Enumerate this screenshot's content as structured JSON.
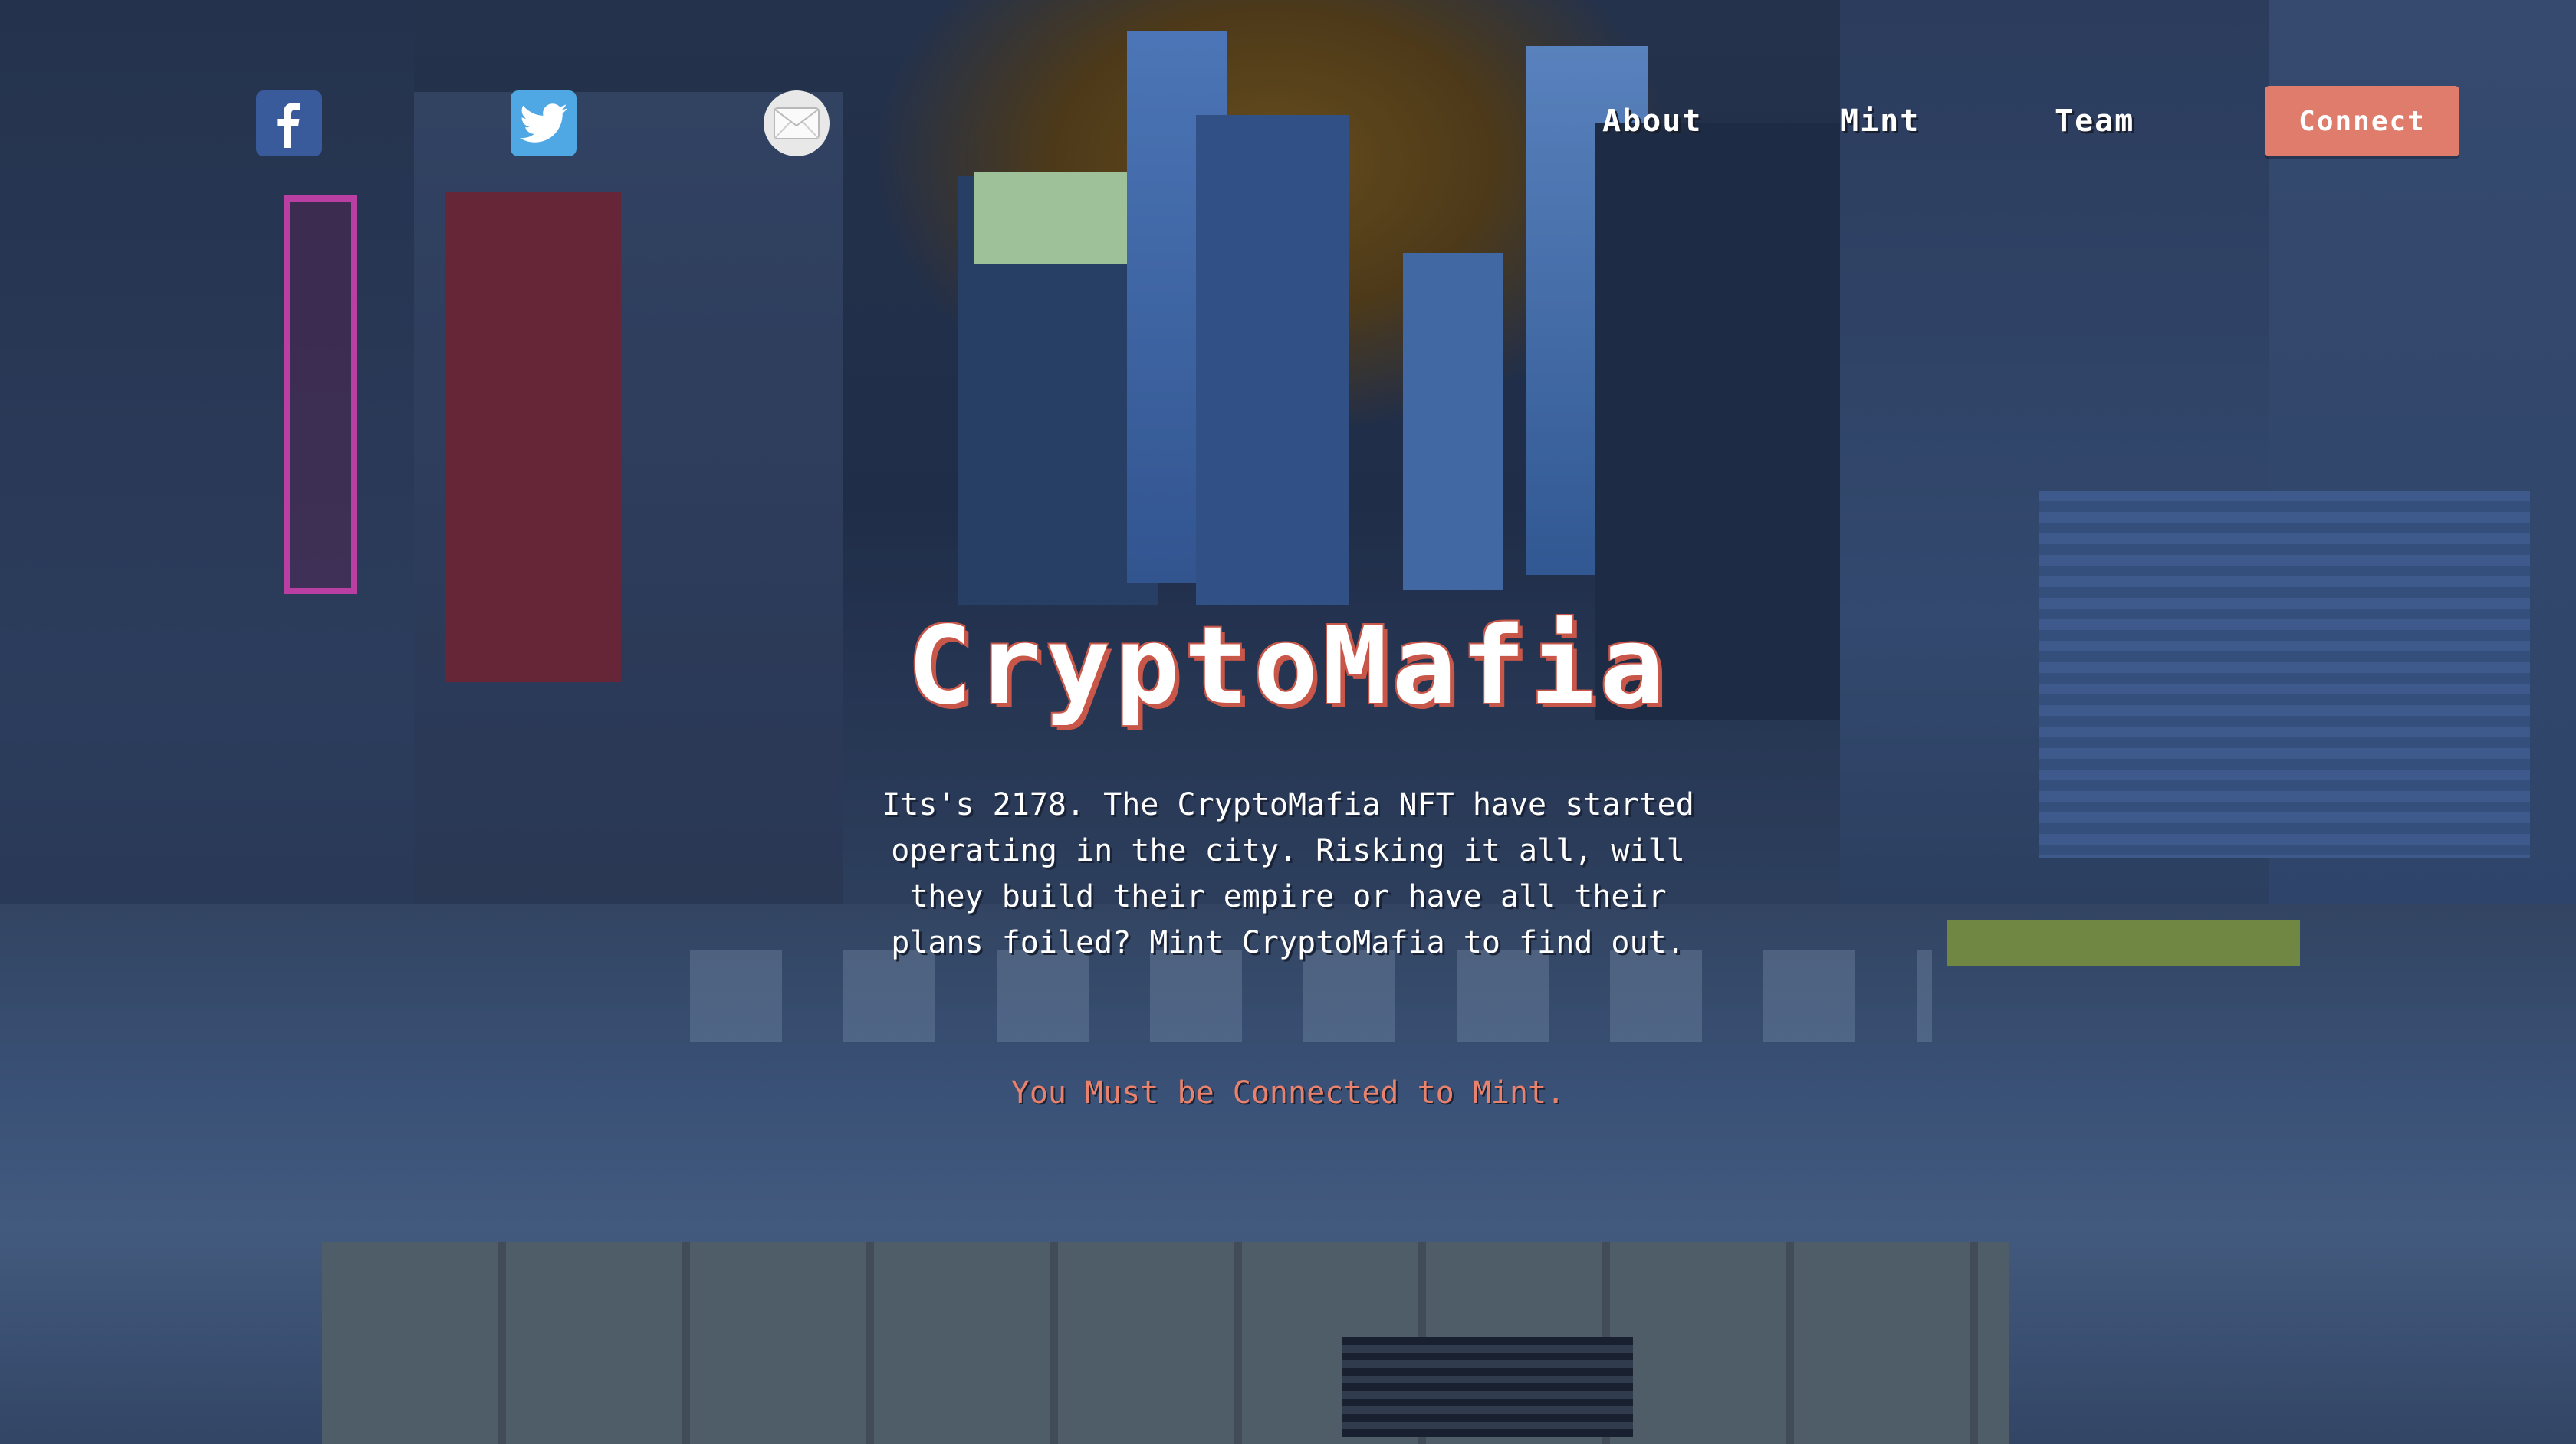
{
  "header": {
    "social": {
      "facebook_icon": "facebook-icon",
      "twitter_icon": "twitter-icon",
      "mail_icon": "mail-icon"
    },
    "nav": {
      "about_label": "About",
      "mint_label": "Mint",
      "team_label": "Team"
    },
    "connect_label": "Connect"
  },
  "hero": {
    "title": "CryptoMafia",
    "description": "Its's 2178. The CryptoMafia NFT have started operating in the city. Risking it all, will they build their empire or have all their plans foiled? Mint CryptoMafia to find out.",
    "mint_status": "You Must be Connected to Mint."
  },
  "colors": {
    "accent": "#e07c6b",
    "title_shadow": "#c8574a",
    "status_text": "#e8826c",
    "facebook": "#3a5b9b",
    "twitter": "#4fa8e4"
  }
}
